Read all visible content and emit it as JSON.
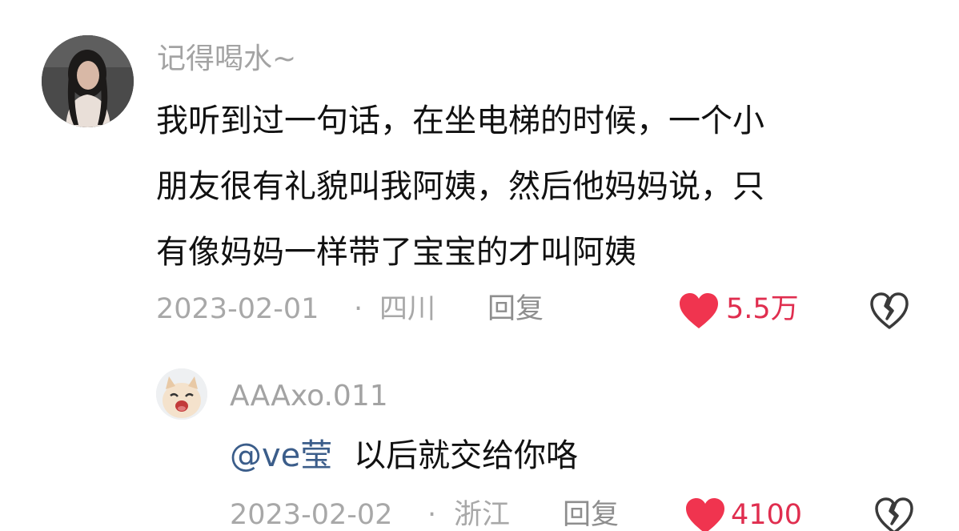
{
  "comment": {
    "username": "记得喝水~",
    "lines": [
      "我听到过一句话，在坐电梯的时候，一个小",
      "朋友很有礼貌叫我阿姨，然后他妈妈说，只",
      "有像妈妈一样带了宝宝的才叫阿姨"
    ],
    "date": "2023-02-01",
    "separator": "·",
    "location": "四川",
    "reply_label": "回复",
    "like_count": "5.5万",
    "like_icon": "heart-icon",
    "dislike_icon": "broken-heart-icon"
  },
  "reply": {
    "username": "AAAxo.011",
    "mention": "@ve莹",
    "text": "以后就交给你咯",
    "date": "2023-02-02",
    "separator": "·",
    "location": "浙江",
    "reply_label": "回复",
    "like_count": "4100",
    "like_icon": "heart-icon"
  },
  "colors": {
    "like_red": "#f0344f",
    "like_count_red": "#e02e4f",
    "mention_blue": "#3b5d8a",
    "meta_gray": "#a8a8a8"
  }
}
